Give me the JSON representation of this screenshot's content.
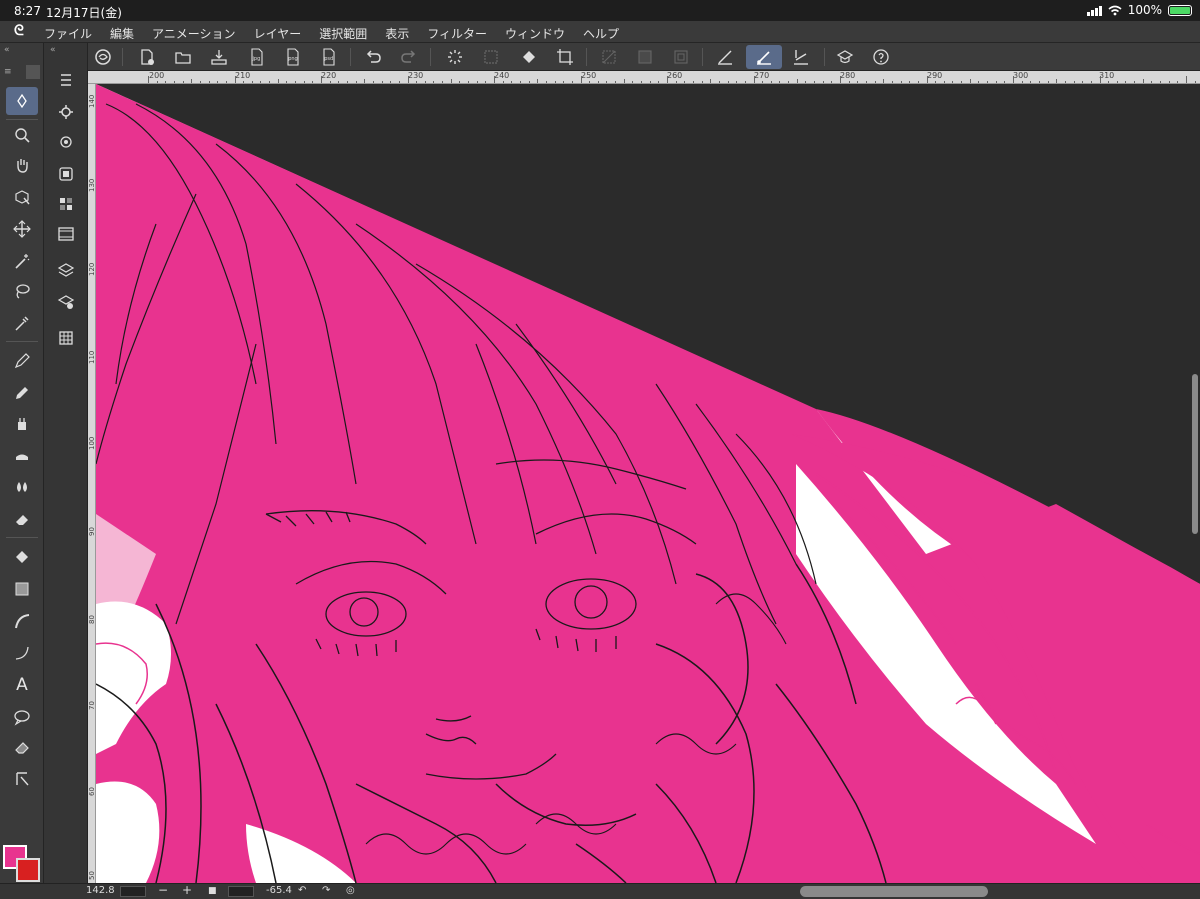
{
  "status": {
    "time": "8:27",
    "date": "12月17日(金)",
    "battery": "100%"
  },
  "menu": {
    "items": [
      "ファイル",
      "編集",
      "アニメーション",
      "レイヤー",
      "選択範囲",
      "表示",
      "フィルター",
      "ウィンドウ",
      "ヘルプ"
    ]
  },
  "toolbar": {
    "icons": [
      "app-logo-icon",
      "new-file-icon",
      "open-folder-icon",
      "save-icon",
      "export-jpg-icon",
      "export-png-icon",
      "export-psd-icon",
      "undo-icon",
      "redo-icon",
      "loading-icon",
      "transform-disabled-icon",
      "fill-bucket-icon",
      "crop-icon",
      "clear-selection-icon",
      "invert-selection-icon",
      "selection-boundary-icon",
      "ruler-pen-icon",
      "brush-ruler-icon",
      "snap-ruler-icon",
      "learn-icon",
      "help-icon"
    ],
    "labels": {
      "jpg": "jpg",
      "png": "png",
      "psd": "psd"
    }
  },
  "tools": {
    "text_tool": "A"
  },
  "ruler": {
    "top": [
      "200",
      "210",
      "220",
      "230",
      "240",
      "250",
      "260",
      "270",
      "280",
      "290",
      "300",
      "310"
    ],
    "left": [
      "140",
      "130",
      "120",
      "110",
      "100",
      "90",
      "80",
      "70",
      "60",
      "50"
    ]
  },
  "bottom": {
    "zoom": "142.8",
    "rotation": "-65.4"
  },
  "colors": {
    "main": "#e8338f",
    "sub": "#d82020",
    "accent": "#5a6b8a"
  }
}
